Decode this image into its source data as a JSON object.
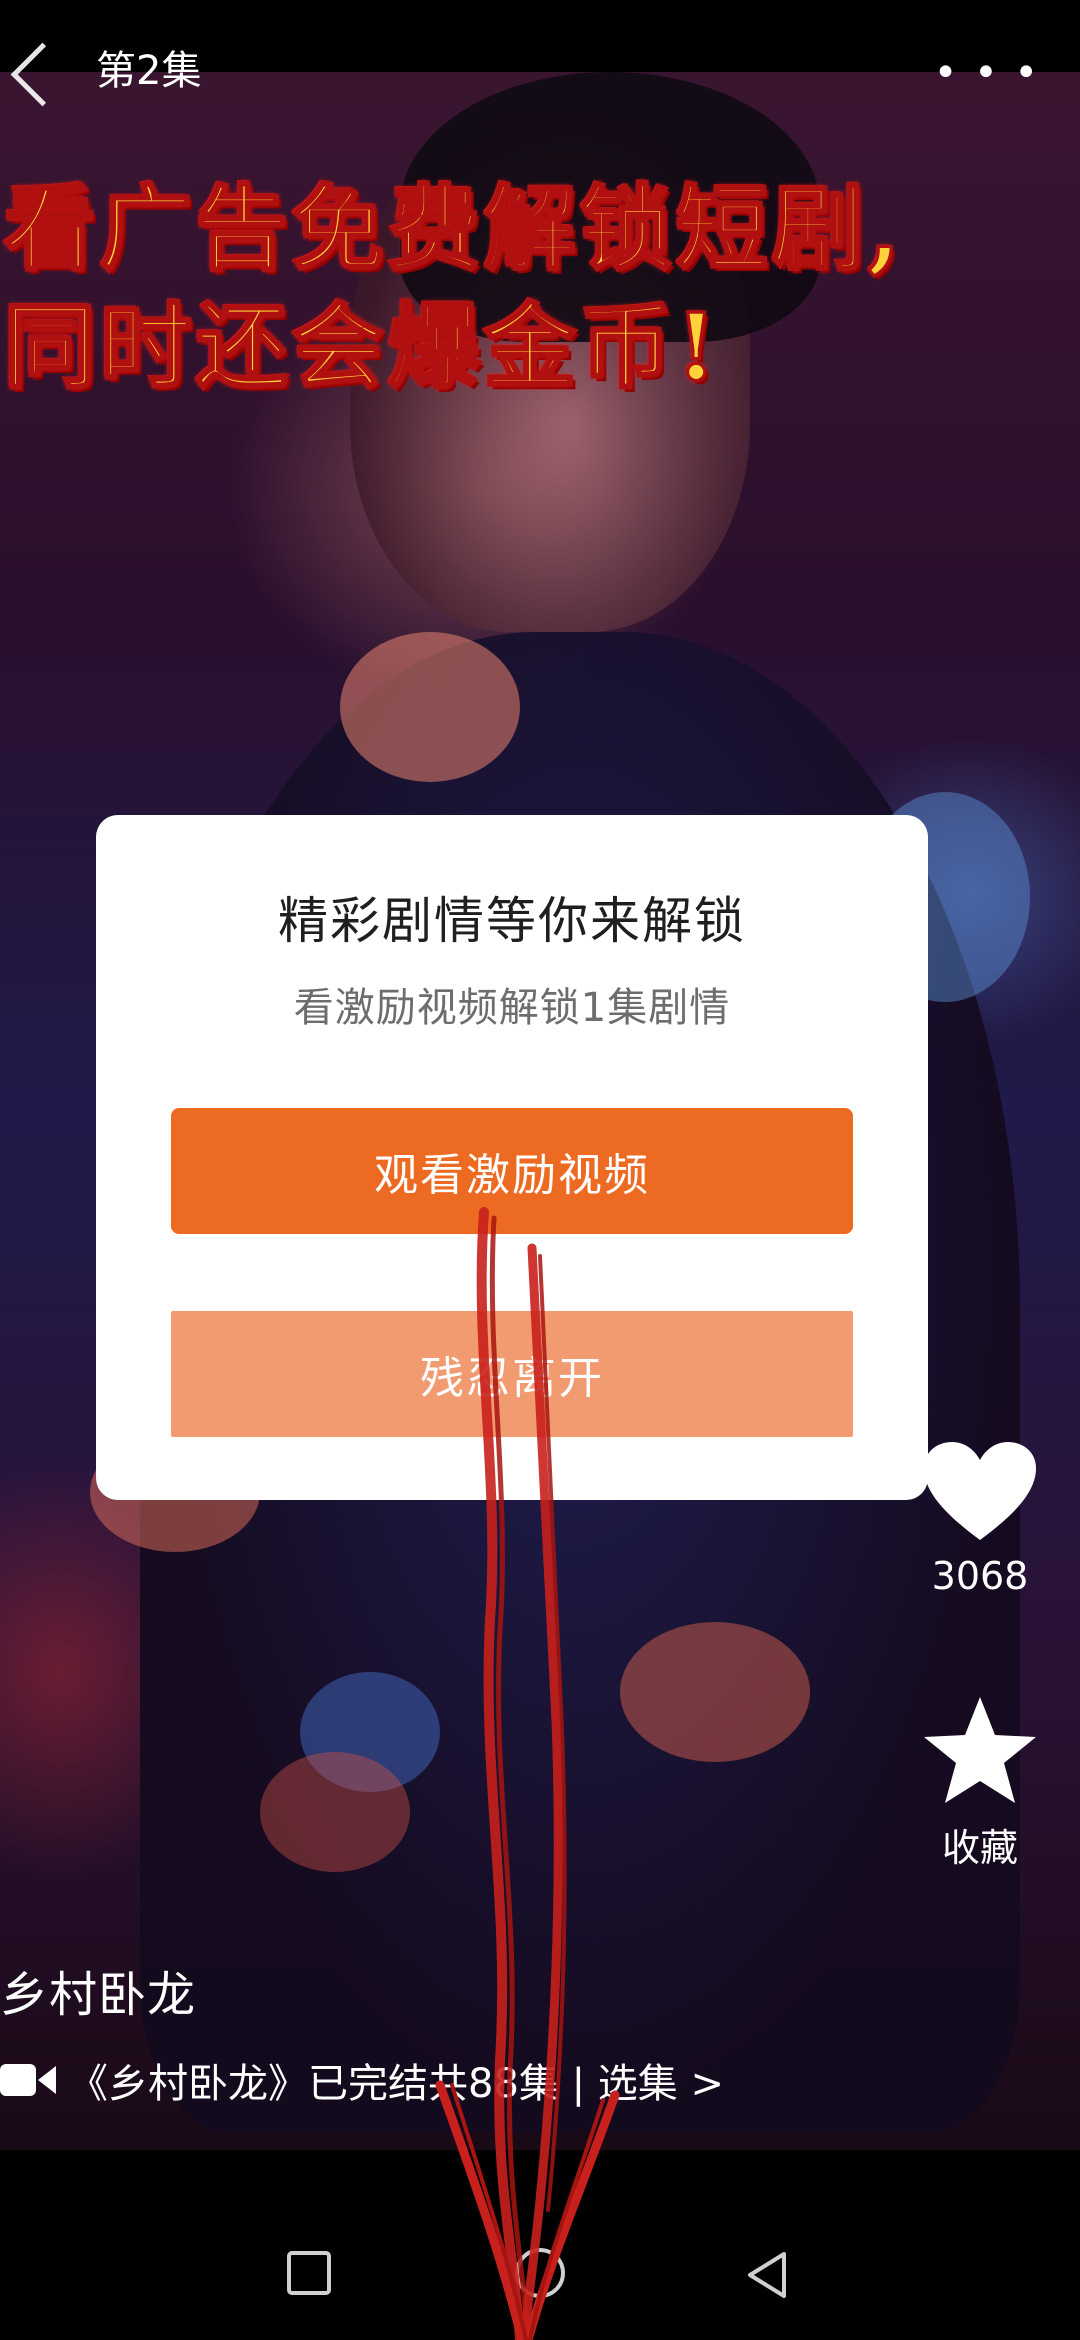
{
  "header": {
    "episode_label": "第2集",
    "more_icon": "more-dots-icon"
  },
  "promo_banner": {
    "line1": "看广告免费解锁短剧,",
    "line2": "同时还会爆金币!"
  },
  "unlock_dialog": {
    "title": "精彩剧情等你来解锁",
    "subtitle": "看激励视频解锁1集剧情",
    "primary_button": "观看激励视频",
    "secondary_button": "残忍离开",
    "colors": {
      "primary": "#ec6a22",
      "secondary": "#f29a70"
    }
  },
  "side_actions": {
    "like_count": "3068",
    "favorite_label": "收藏"
  },
  "drama": {
    "title": "乡村卧龙",
    "info": "《乡村卧龙》已完结共88集 | 选集 >"
  },
  "nav_bar": {
    "icons": [
      "recents-square-icon",
      "home-circle-icon",
      "back-triangle-icon"
    ]
  },
  "annotation": {
    "arrow_color": "#c8201c"
  }
}
